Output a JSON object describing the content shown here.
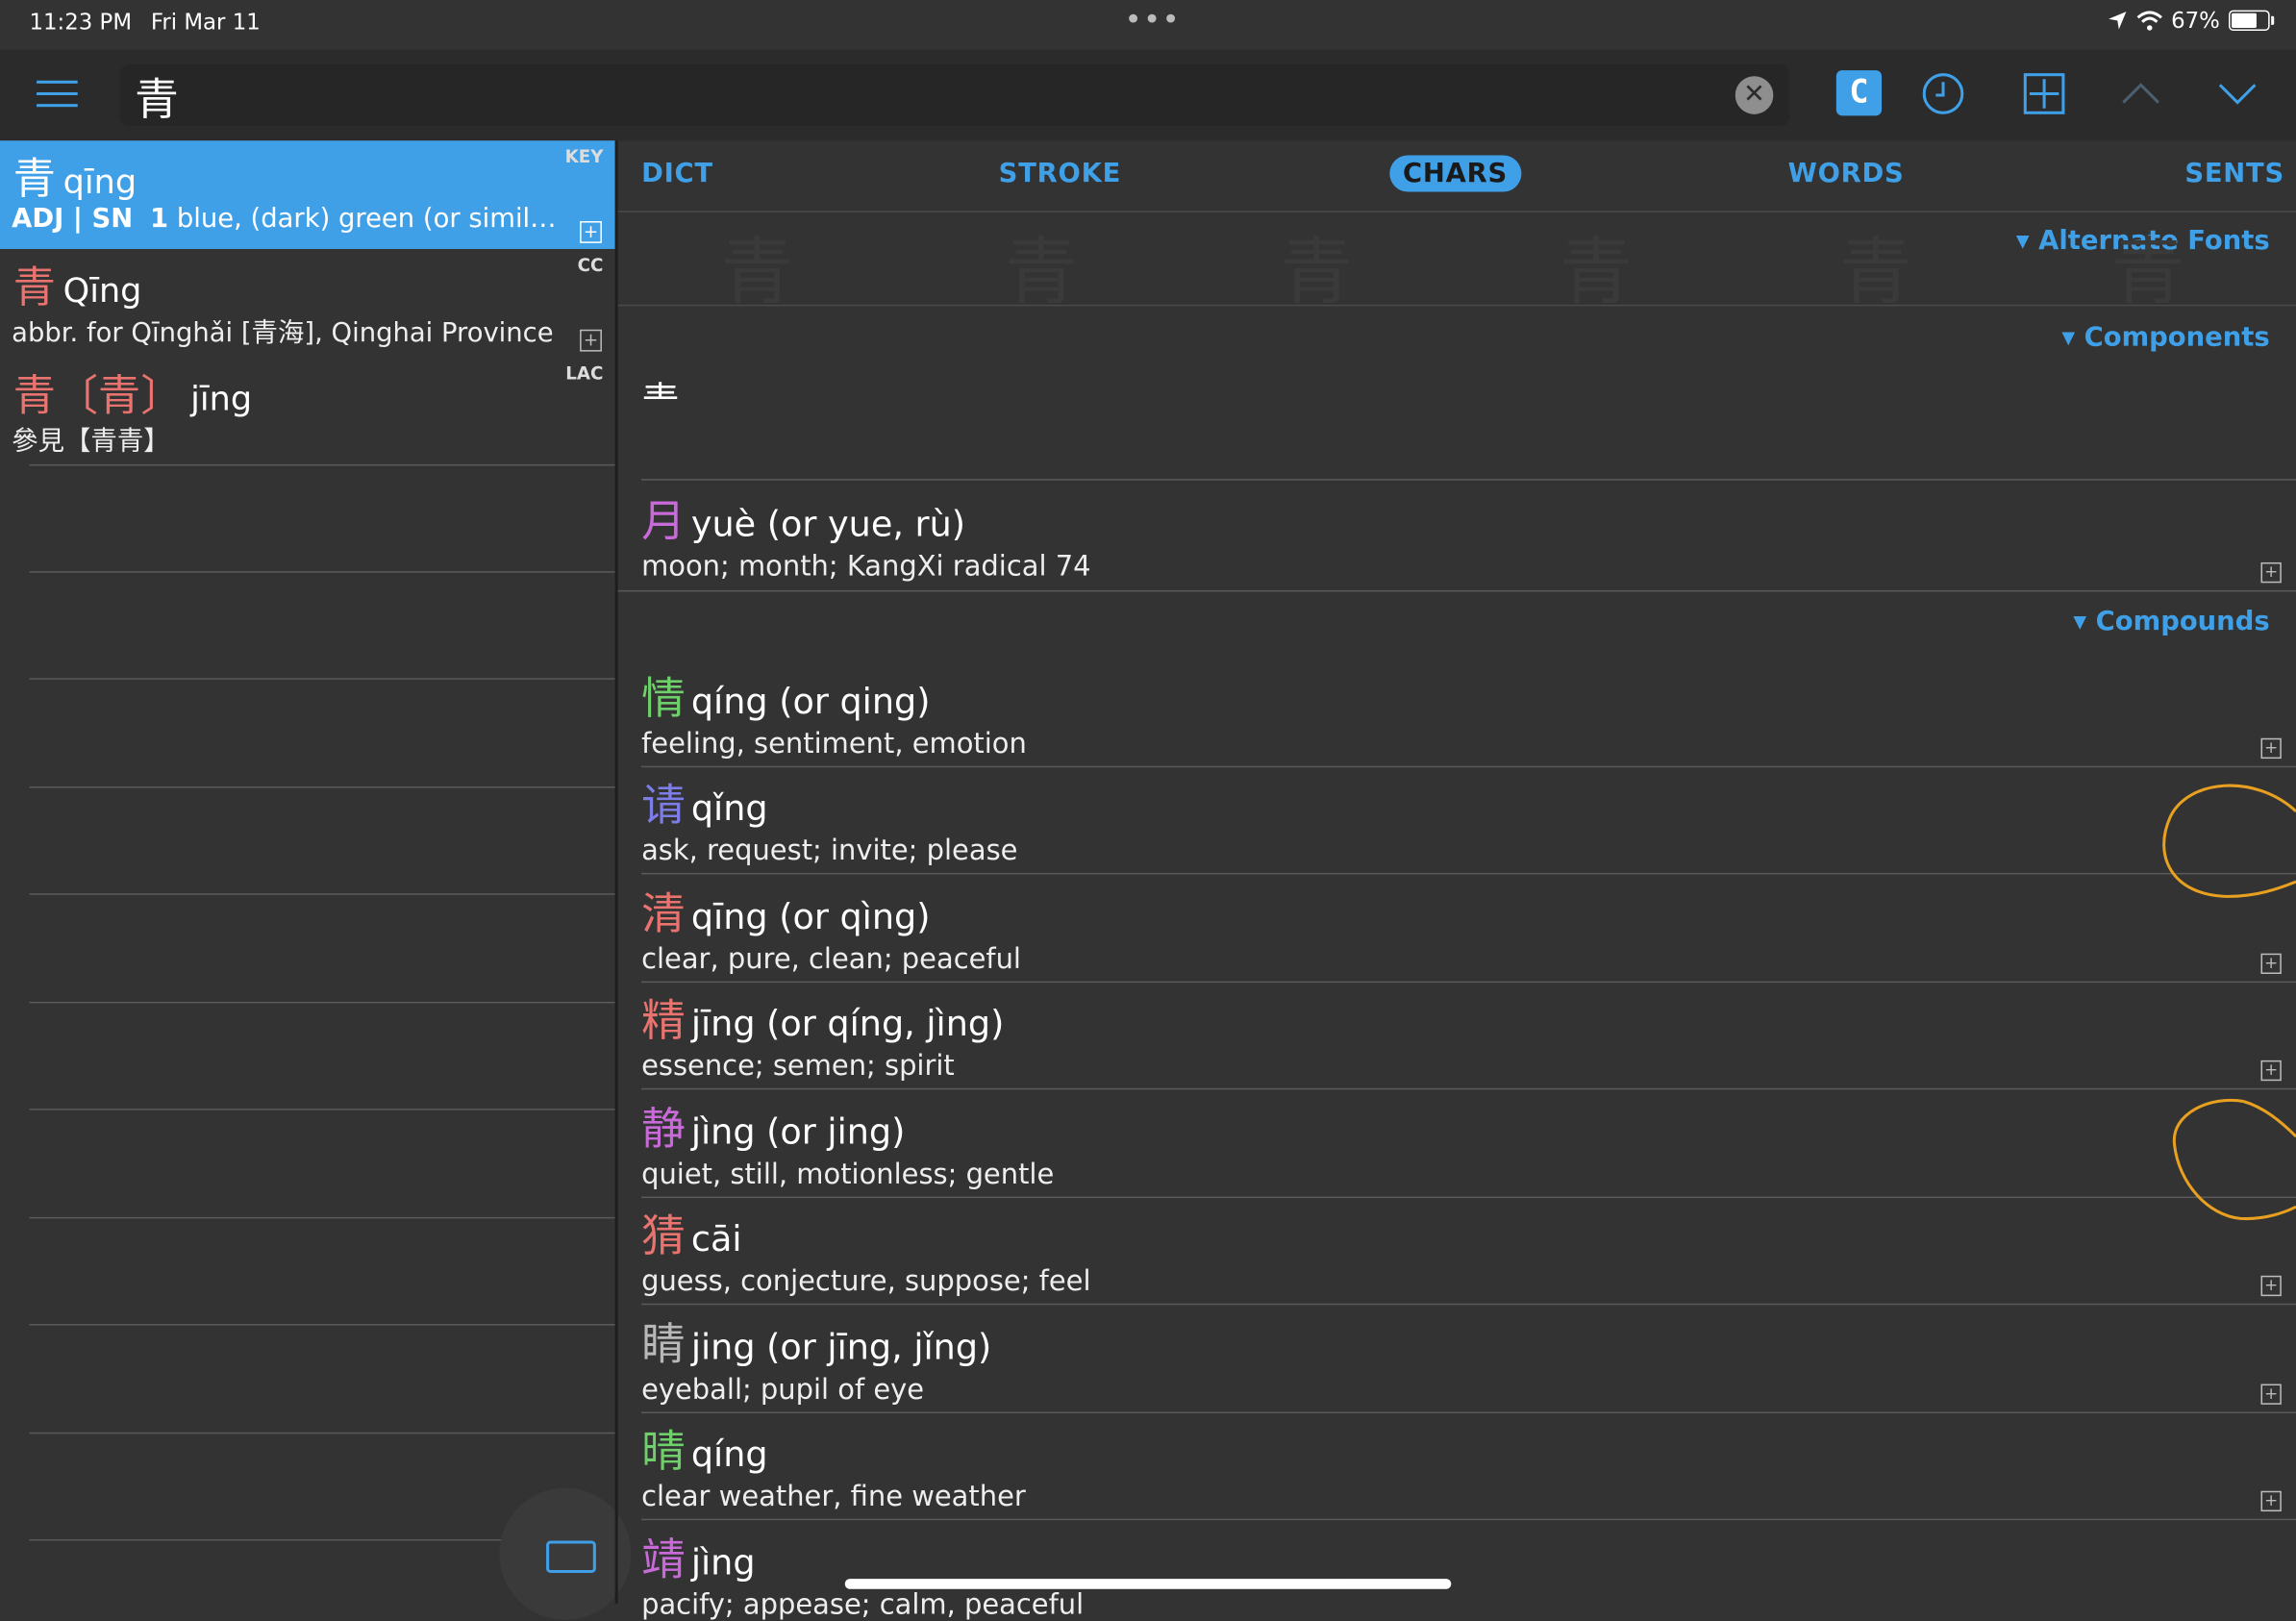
{
  "status": {
    "time": "11:23 PM",
    "date": "Fri Mar 11",
    "battery": "67%",
    "battery_level": 0.67
  },
  "search": {
    "value": "青"
  },
  "toolbar": {
    "c_label": "C"
  },
  "left_entries": [
    {
      "hz": "青",
      "py": "qīng",
      "tag": "KEY",
      "def_tags": "ADJ | SN",
      "def_num": "1",
      "def": "blue, (dark) green (or similar …"
    },
    {
      "hz": "青",
      "py": "Qīng",
      "tag": "CC",
      "def": "abbr. for Qīnghǎi [青海], Qinghai Province"
    },
    {
      "hz": "青〔青〕",
      "py": "jīng",
      "tag": "LAC",
      "def": "參見【青青】"
    }
  ],
  "tabs": [
    "DICT",
    "STROKE",
    "CHARS",
    "WORDS",
    "SENTS"
  ],
  "active_tab": "CHARS",
  "sections": {
    "alt_fonts": "▾ Alternate Fonts",
    "components": "▾ Components",
    "compounds": "▾ Compounds"
  },
  "component_glyph": "龶",
  "radical": {
    "hz": "月",
    "py": "yuè (or yue, rù)",
    "def": "moon; month; KangXi radical 74",
    "color": "#c86ad8"
  },
  "compounds": [
    {
      "hz": "情",
      "py": "qíng (or qing)",
      "def": "feeling, sentiment, emotion",
      "color": "#6fcf6a"
    },
    {
      "hz": "请",
      "py": "qǐng",
      "def": "ask, request; invite; please",
      "color": "#7d7de8"
    },
    {
      "hz": "清",
      "py": "qīng (or qìng)",
      "def": "clear, pure, clean; peaceful",
      "color": "#e8736f"
    },
    {
      "hz": "精",
      "py": "jīng (or qíng, jìng)",
      "def": "essence; semen; spirit",
      "color": "#e8736f"
    },
    {
      "hz": "静",
      "py": "jìng (or jing)",
      "def": "quiet, still, motionless; gentle",
      "color": "#c86ad8"
    },
    {
      "hz": "猜",
      "py": "cāi",
      "def": "guess, conjecture, suppose; feel",
      "color": "#e8736f"
    },
    {
      "hz": "睛",
      "py": "jing (or jīng, jǐng)",
      "def": "eyeball; pupil of eye",
      "color": "#b8b8b8"
    },
    {
      "hz": "晴",
      "py": "qíng",
      "def": "clear weather, fine weather",
      "color": "#6fcf6a"
    },
    {
      "hz": "靖",
      "py": "jìng",
      "def": "pacify; appease; calm, peaceful",
      "color": "#c86ad8"
    }
  ],
  "colors": {
    "accent": "#3fa0e8",
    "annotation": "#e8a020"
  }
}
